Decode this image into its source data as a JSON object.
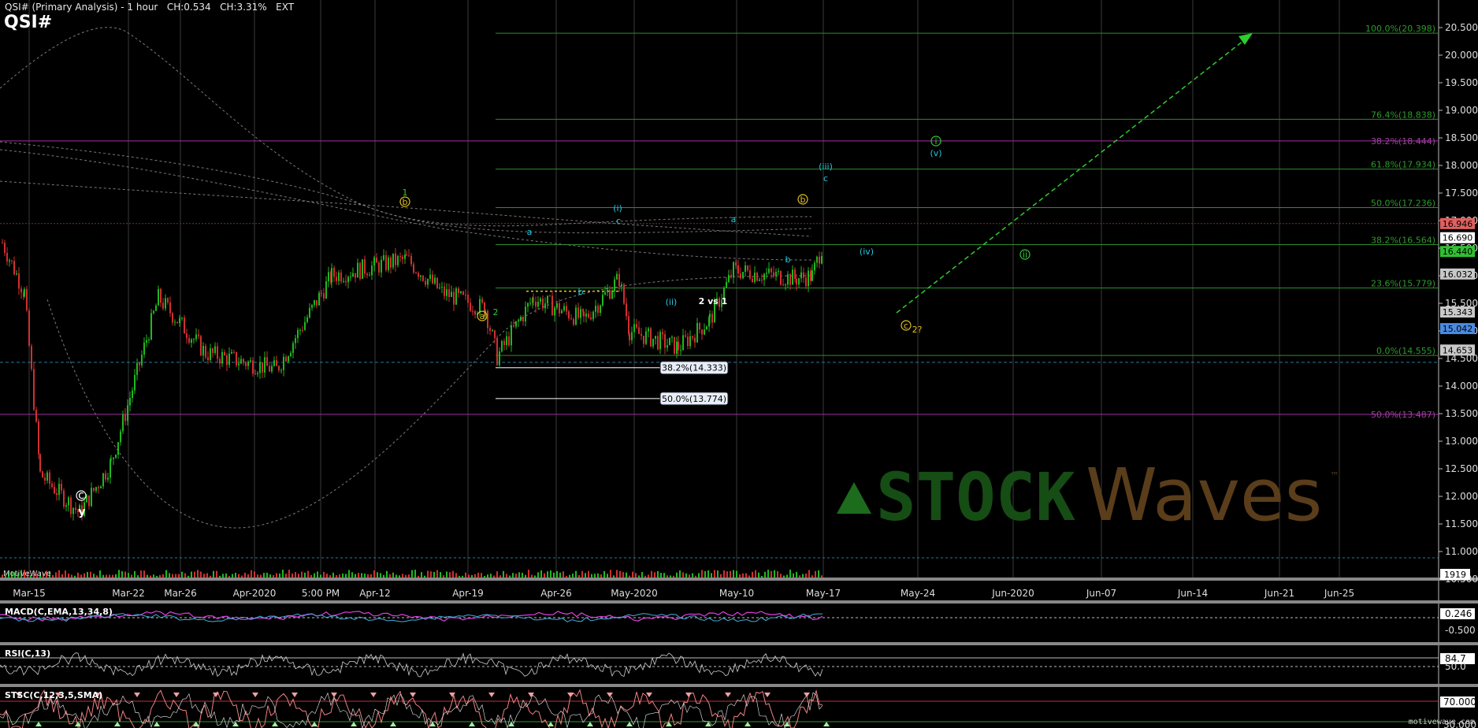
{
  "header": {
    "title": "QSI# (Primary Analysis) - 1 hour",
    "change_abs": "CH:0.534",
    "change_pct": "CH:3.31%",
    "session": "EXT",
    "symbol": "QSI#"
  },
  "branding": {
    "motivewave": "MotiveWave",
    "credit": "motivewave.com",
    "watermark_a": "STOCK",
    "watermark_b": "Waves",
    "watermark_tm": "™"
  },
  "colors": {
    "background": "#000000",
    "fib_line": "#2e8b2e",
    "magenta_line": "#b030b0",
    "up_candle": "#1fb81f",
    "down_candle": "#d03030"
  },
  "chart_data": {
    "type": "candlestick",
    "price_axis": {
      "min": 10.5,
      "max": 21.0,
      "ticks": [
        "20.500",
        "20.000",
        "19.500",
        "19.000",
        "18.500",
        "18.000",
        "17.500",
        "17.000",
        "16.500",
        "16.000",
        "15.500",
        "15.000",
        "14.500",
        "14.000",
        "13.500",
        "13.000",
        "12.500",
        "12.000",
        "11.500",
        "11.000",
        "10.500"
      ]
    },
    "date_axis": {
      "labels": [
        "Mar-15",
        "Mar-22",
        "Mar-26",
        "Apr-2020",
        "5:00 PM",
        "Apr-12",
        "Apr-19",
        "Apr-26",
        "May-2020",
        "May-10",
        "May-17",
        "May-24",
        "Jun-2020",
        "Jun-07",
        "Jun-14",
        "Jun-21",
        "Jun-25"
      ]
    },
    "price_labels": [
      {
        "text": "16.946",
        "value": 16.946,
        "bg": "#e06060"
      },
      {
        "text": "16.690",
        "value": 16.69,
        "bg": "#ffffff"
      },
      {
        "text": "16.440",
        "value": 16.44,
        "bg": "#30c030"
      },
      {
        "text": "16.032",
        "value": 16.032,
        "bg": "#c8c8c8"
      },
      {
        "text": "15.343",
        "value": 15.343,
        "bg": "#c8c8c8"
      },
      {
        "text": "15.042",
        "value": 15.042,
        "bg": "#4a8ae0"
      },
      {
        "text": "14.653",
        "value": 14.653,
        "bg": "#c8c8c8"
      }
    ],
    "fib_levels": [
      {
        "text": "100.0%(20.398)",
        "value": 20.398
      },
      {
        "text": "76.4%(18.838)",
        "value": 18.838
      },
      {
        "text": "61.8%(17.934)",
        "value": 17.934
      },
      {
        "text": "50.0%(17.236)",
        "value": 17.236
      },
      {
        "text": "38.2%(16.564)",
        "value": 16.564
      },
      {
        "text": "23.6%(15.779)",
        "value": 15.779
      },
      {
        "text": "0.0%(14.555)",
        "value": 14.555
      }
    ],
    "magenta_levels": [
      {
        "text": "38.2%(18.444)",
        "value": 18.444
      },
      {
        "text": "50.0%(13.487)",
        "value": 13.487
      }
    ],
    "retracement_boxes": [
      {
        "text": "38.2%(14.333)",
        "value": 14.333
      },
      {
        "text": "50.0%(13.774)",
        "value": 13.774
      }
    ],
    "volume_label": "1919",
    "wave_labels": [
      {
        "text": "1",
        "color": "#2ecc2e"
      },
      {
        "text": "b",
        "color": "#e0c020"
      },
      {
        "text": "a",
        "color": "#20c8e0"
      },
      {
        "text": "(i)",
        "color": "#20c8e0"
      },
      {
        "text": "c",
        "color": "#20c8e0"
      },
      {
        "text": "b",
        "color": "#20c8e0"
      },
      {
        "text": "a",
        "color": "#e0c020"
      },
      {
        "text": "2",
        "color": "#2ecc2e"
      },
      {
        "text": "(ii)",
        "color": "#20c8e0"
      },
      {
        "text": "2 vs 1",
        "color": "#ffffff"
      },
      {
        "text": "a",
        "color": "#20c8e0"
      },
      {
        "text": "b",
        "color": "#20c8e0"
      },
      {
        "text": "b",
        "color": "#e0c020"
      },
      {
        "text": "(iii)",
        "color": "#20c8e0"
      },
      {
        "text": "c",
        "color": "#20c8e0"
      },
      {
        "text": "(iv)",
        "color": "#20c8e0"
      },
      {
        "text": "i",
        "color": "#2ecc2e"
      },
      {
        "text": "(v)",
        "color": "#20c8e0"
      },
      {
        "text": "ii",
        "color": "#2ecc2e"
      },
      {
        "text": "c",
        "color": "#e0c020"
      },
      {
        "text": "2?",
        "color": "#e0c020"
      },
      {
        "text": "c",
        "color": "#ffffff"
      },
      {
        "text": "y",
        "color": "#ffffff"
      }
    ],
    "indicators": [
      {
        "name": "MACD(C,EMA,13,34,8)",
        "value": "0.246",
        "ticks": [
          "-0.500"
        ]
      },
      {
        "name": "RSI(C,13)",
        "value": "84.7",
        "ticks": [
          "50.0"
        ]
      },
      {
        "name": "STSC(C,12,3,5,SMA)",
        "value": "70.000",
        "ticks": [
          "30.000"
        ]
      }
    ]
  }
}
